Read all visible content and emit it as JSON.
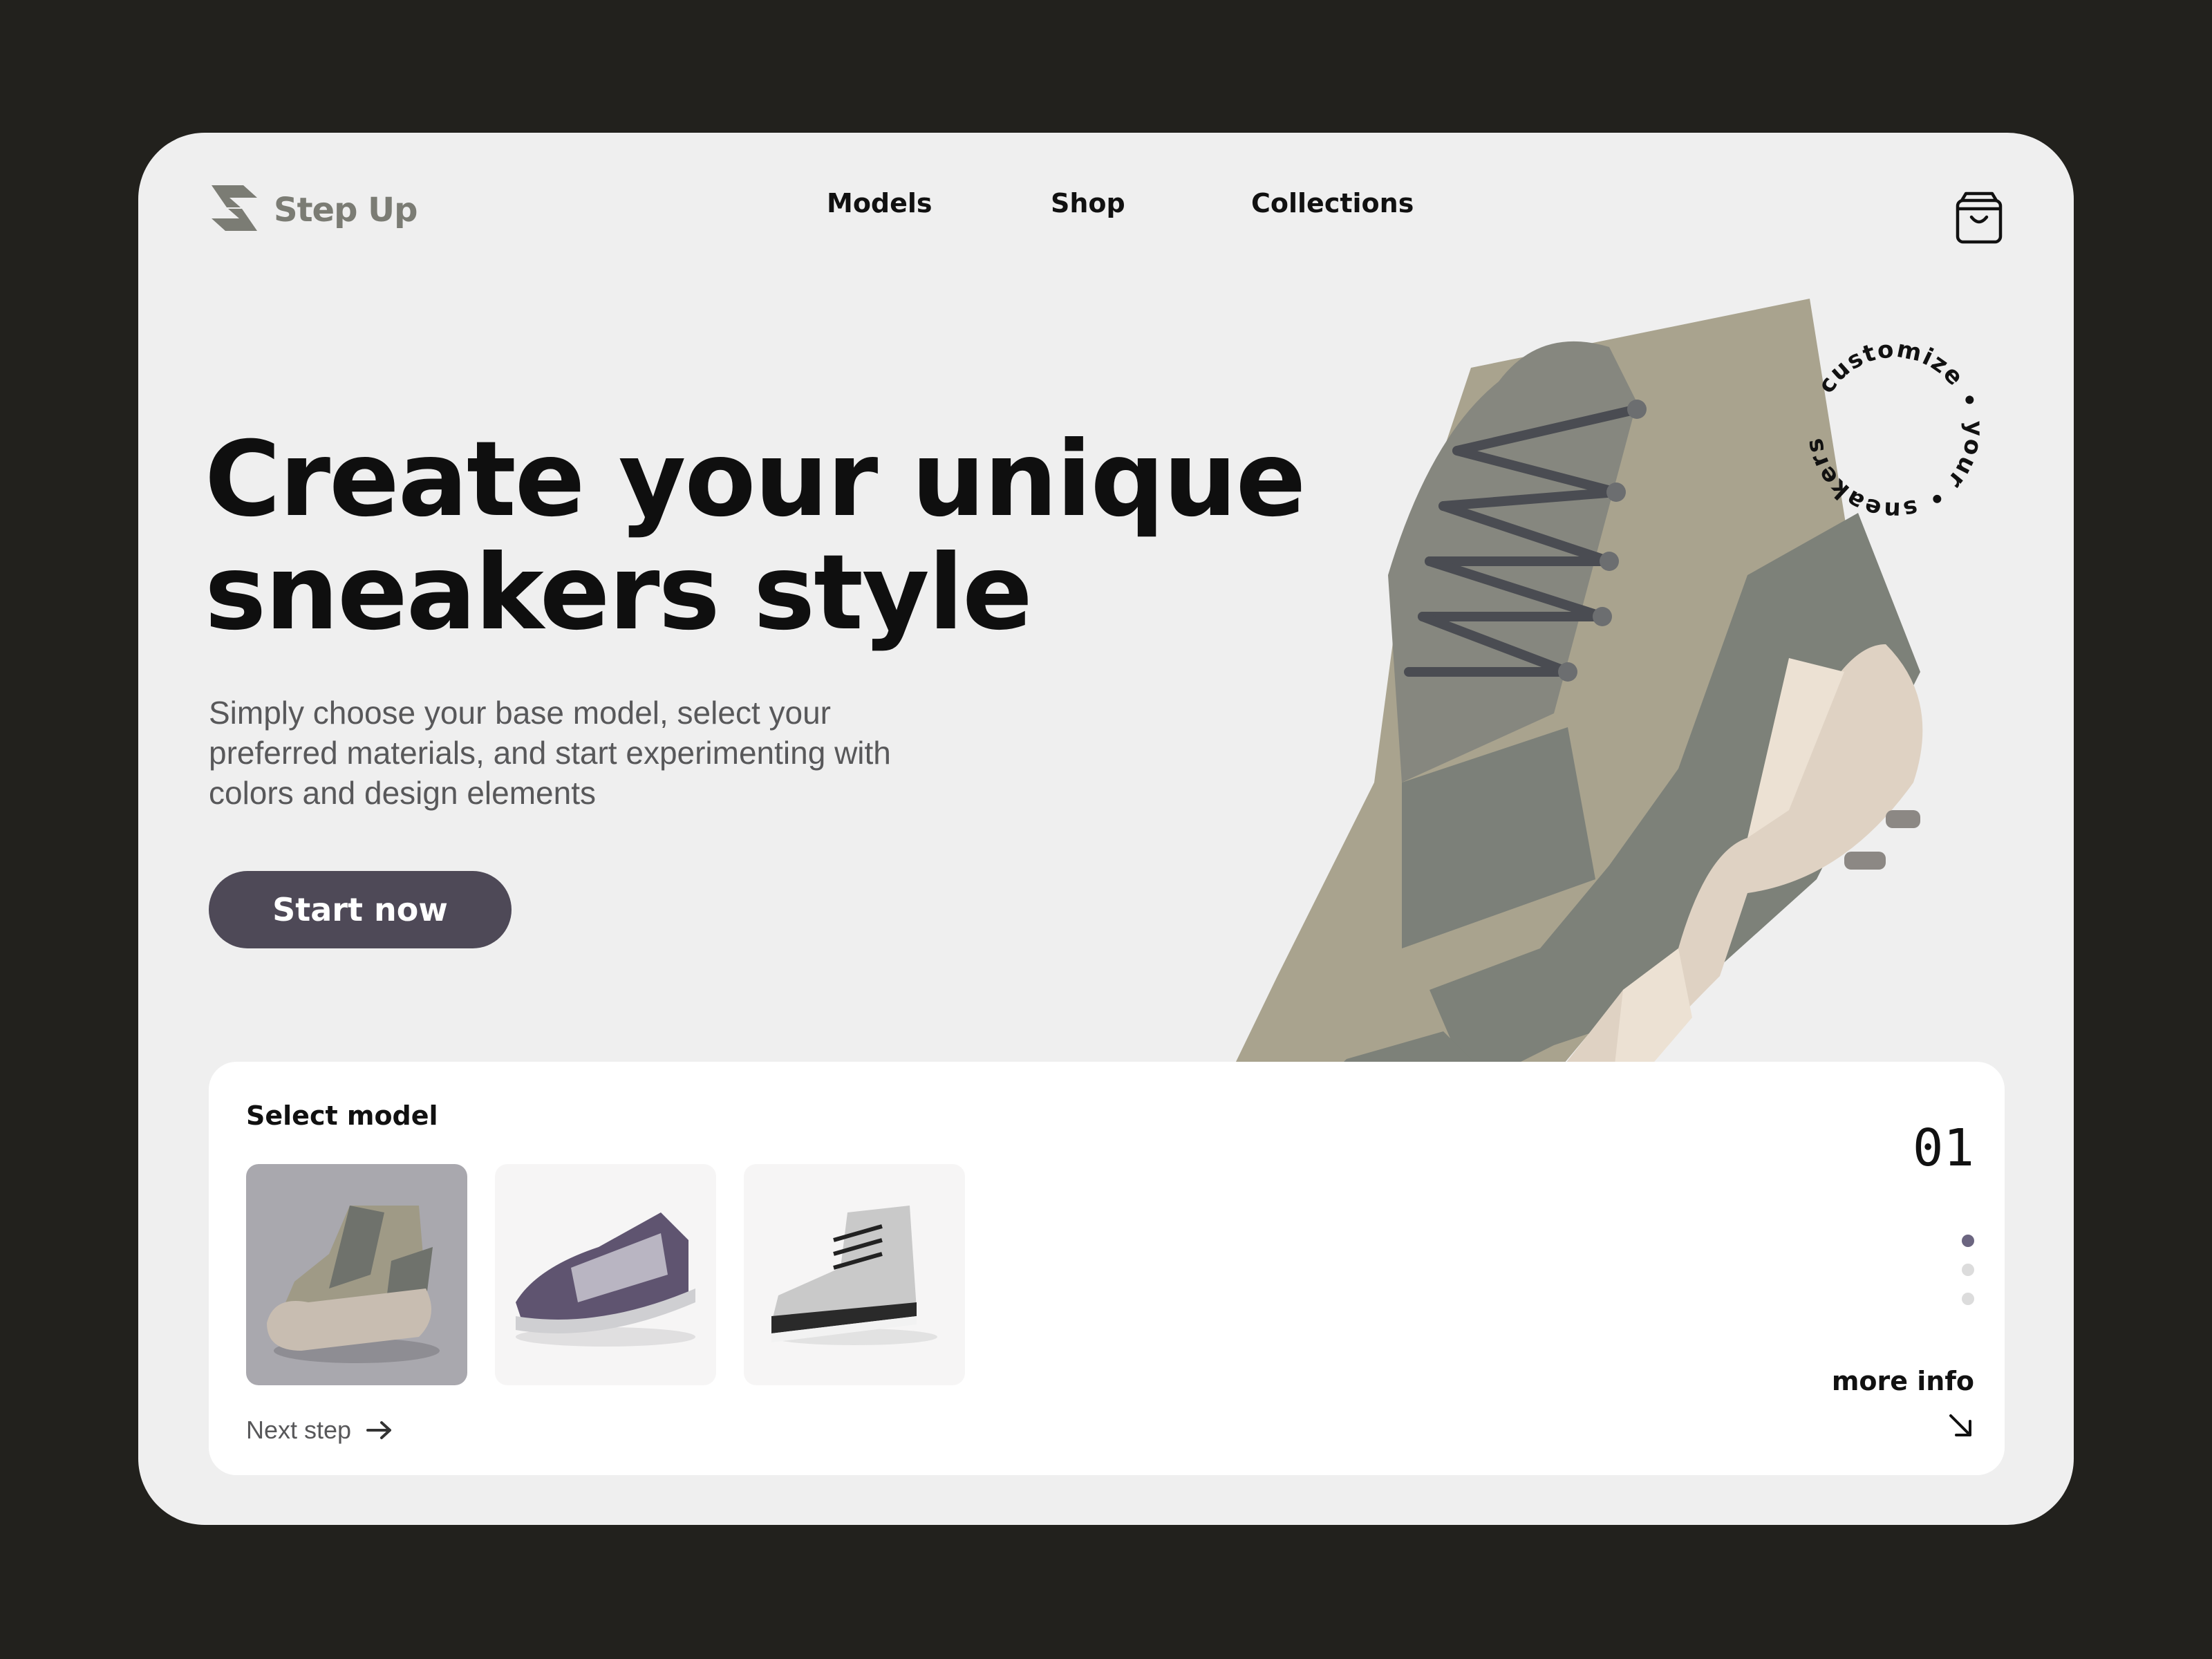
{
  "brand": {
    "name": "Step Up"
  },
  "nav": {
    "items": [
      "Models",
      "Shop",
      "Collections"
    ]
  },
  "hero": {
    "headline_line1": "Create your unique",
    "headline_line2": "sneakers style",
    "subtitle": "Simply choose your base model, select your preferred materials, and start experimenting with colors and design elements",
    "cta": "Start now"
  },
  "badge": {
    "text": "customize • your • sneakers •"
  },
  "panel": {
    "title": "Select model",
    "next_step": "Next step",
    "counter": "01",
    "more_info": "more info",
    "models": [
      "model-1",
      "model-2",
      "model-3"
    ],
    "selected_index": 0,
    "active_dot": 0,
    "dots_total": 3
  },
  "icons": {
    "logo": "step-up-logo-icon",
    "cart": "shopping-bag-icon",
    "next": "arrow-right-icon",
    "more": "arrow-down-right-icon"
  },
  "colors": {
    "background": "#22211d",
    "card": "#efefef",
    "accent": "#4e4957",
    "logo": "#7b7c74",
    "active_dot": "#6b6580"
  }
}
